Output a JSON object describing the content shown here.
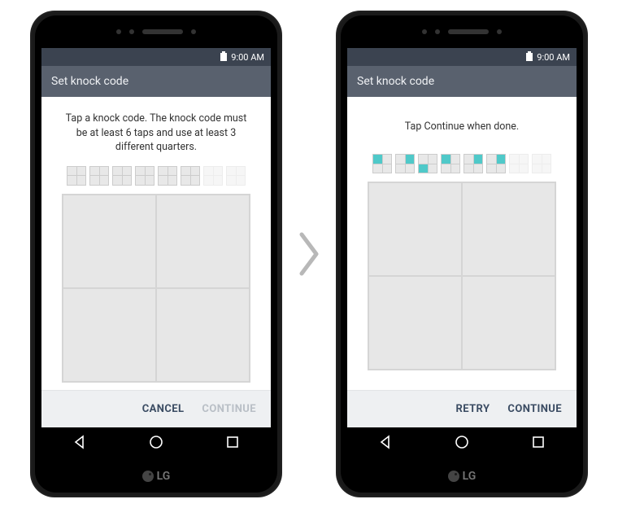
{
  "status": {
    "time": "9:00 AM"
  },
  "appbar": {
    "title": "Set knock code"
  },
  "brand": "LG",
  "left": {
    "instruction": "Tap a knock code. The knock code must be at least 6 taps and use at least 3 different quarters.",
    "indicators": [
      {
        "highlight": null,
        "faded": false
      },
      {
        "highlight": null,
        "faded": false
      },
      {
        "highlight": null,
        "faded": false
      },
      {
        "highlight": null,
        "faded": false
      },
      {
        "highlight": null,
        "faded": false
      },
      {
        "highlight": null,
        "faded": false
      },
      {
        "highlight": null,
        "faded": true
      },
      {
        "highlight": null,
        "faded": true
      }
    ],
    "buttons": {
      "left": "CANCEL",
      "right": "CONTINUE",
      "right_enabled": false
    }
  },
  "right": {
    "instruction": "Tap Continue when done.",
    "indicators": [
      {
        "highlight": 0,
        "faded": false
      },
      {
        "highlight": 1,
        "faded": false
      },
      {
        "highlight": 2,
        "faded": false
      },
      {
        "highlight": 0,
        "faded": false
      },
      {
        "highlight": 1,
        "faded": false
      },
      {
        "highlight": 1,
        "faded": false
      },
      {
        "highlight": null,
        "faded": true
      },
      {
        "highlight": null,
        "faded": true
      }
    ],
    "buttons": {
      "left": "RETRY",
      "right": "CONTINUE",
      "right_enabled": true
    }
  }
}
